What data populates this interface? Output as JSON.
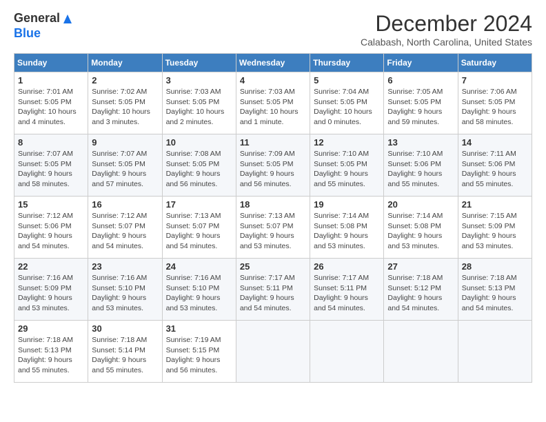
{
  "header": {
    "logo_line1": "General",
    "logo_line2": "Blue",
    "month_title": "December 2024",
    "location": "Calabash, North Carolina, United States"
  },
  "weekdays": [
    "Sunday",
    "Monday",
    "Tuesday",
    "Wednesday",
    "Thursday",
    "Friday",
    "Saturday"
  ],
  "weeks": [
    [
      {
        "day": "1",
        "sunrise": "7:01 AM",
        "sunset": "5:05 PM",
        "daylight": "10 hours and 4 minutes."
      },
      {
        "day": "2",
        "sunrise": "7:02 AM",
        "sunset": "5:05 PM",
        "daylight": "10 hours and 3 minutes."
      },
      {
        "day": "3",
        "sunrise": "7:03 AM",
        "sunset": "5:05 PM",
        "daylight": "10 hours and 2 minutes."
      },
      {
        "day": "4",
        "sunrise": "7:03 AM",
        "sunset": "5:05 PM",
        "daylight": "10 hours and 1 minute."
      },
      {
        "day": "5",
        "sunrise": "7:04 AM",
        "sunset": "5:05 PM",
        "daylight": "10 hours and 0 minutes."
      },
      {
        "day": "6",
        "sunrise": "7:05 AM",
        "sunset": "5:05 PM",
        "daylight": "9 hours and 59 minutes."
      },
      {
        "day": "7",
        "sunrise": "7:06 AM",
        "sunset": "5:05 PM",
        "daylight": "9 hours and 58 minutes."
      }
    ],
    [
      {
        "day": "8",
        "sunrise": "7:07 AM",
        "sunset": "5:05 PM",
        "daylight": "9 hours and 58 minutes."
      },
      {
        "day": "9",
        "sunrise": "7:07 AM",
        "sunset": "5:05 PM",
        "daylight": "9 hours and 57 minutes."
      },
      {
        "day": "10",
        "sunrise": "7:08 AM",
        "sunset": "5:05 PM",
        "daylight": "9 hours and 56 minutes."
      },
      {
        "day": "11",
        "sunrise": "7:09 AM",
        "sunset": "5:05 PM",
        "daylight": "9 hours and 56 minutes."
      },
      {
        "day": "12",
        "sunrise": "7:10 AM",
        "sunset": "5:05 PM",
        "daylight": "9 hours and 55 minutes."
      },
      {
        "day": "13",
        "sunrise": "7:10 AM",
        "sunset": "5:06 PM",
        "daylight": "9 hours and 55 minutes."
      },
      {
        "day": "14",
        "sunrise": "7:11 AM",
        "sunset": "5:06 PM",
        "daylight": "9 hours and 55 minutes."
      }
    ],
    [
      {
        "day": "15",
        "sunrise": "7:12 AM",
        "sunset": "5:06 PM",
        "daylight": "9 hours and 54 minutes."
      },
      {
        "day": "16",
        "sunrise": "7:12 AM",
        "sunset": "5:07 PM",
        "daylight": "9 hours and 54 minutes."
      },
      {
        "day": "17",
        "sunrise": "7:13 AM",
        "sunset": "5:07 PM",
        "daylight": "9 hours and 54 minutes."
      },
      {
        "day": "18",
        "sunrise": "7:13 AM",
        "sunset": "5:07 PM",
        "daylight": "9 hours and 53 minutes."
      },
      {
        "day": "19",
        "sunrise": "7:14 AM",
        "sunset": "5:08 PM",
        "daylight": "9 hours and 53 minutes."
      },
      {
        "day": "20",
        "sunrise": "7:14 AM",
        "sunset": "5:08 PM",
        "daylight": "9 hours and 53 minutes."
      },
      {
        "day": "21",
        "sunrise": "7:15 AM",
        "sunset": "5:09 PM",
        "daylight": "9 hours and 53 minutes."
      }
    ],
    [
      {
        "day": "22",
        "sunrise": "7:16 AM",
        "sunset": "5:09 PM",
        "daylight": "9 hours and 53 minutes."
      },
      {
        "day": "23",
        "sunrise": "7:16 AM",
        "sunset": "5:10 PM",
        "daylight": "9 hours and 53 minutes."
      },
      {
        "day": "24",
        "sunrise": "7:16 AM",
        "sunset": "5:10 PM",
        "daylight": "9 hours and 53 minutes."
      },
      {
        "day": "25",
        "sunrise": "7:17 AM",
        "sunset": "5:11 PM",
        "daylight": "9 hours and 54 minutes."
      },
      {
        "day": "26",
        "sunrise": "7:17 AM",
        "sunset": "5:11 PM",
        "daylight": "9 hours and 54 minutes."
      },
      {
        "day": "27",
        "sunrise": "7:18 AM",
        "sunset": "5:12 PM",
        "daylight": "9 hours and 54 minutes."
      },
      {
        "day": "28",
        "sunrise": "7:18 AM",
        "sunset": "5:13 PM",
        "daylight": "9 hours and 54 minutes."
      }
    ],
    [
      {
        "day": "29",
        "sunrise": "7:18 AM",
        "sunset": "5:13 PM",
        "daylight": "9 hours and 55 minutes."
      },
      {
        "day": "30",
        "sunrise": "7:18 AM",
        "sunset": "5:14 PM",
        "daylight": "9 hours and 55 minutes."
      },
      {
        "day": "31",
        "sunrise": "7:19 AM",
        "sunset": "5:15 PM",
        "daylight": "9 hours and 56 minutes."
      },
      null,
      null,
      null,
      null
    ]
  ],
  "labels": {
    "sunrise": "Sunrise:",
    "sunset": "Sunset:",
    "daylight": "Daylight:"
  }
}
